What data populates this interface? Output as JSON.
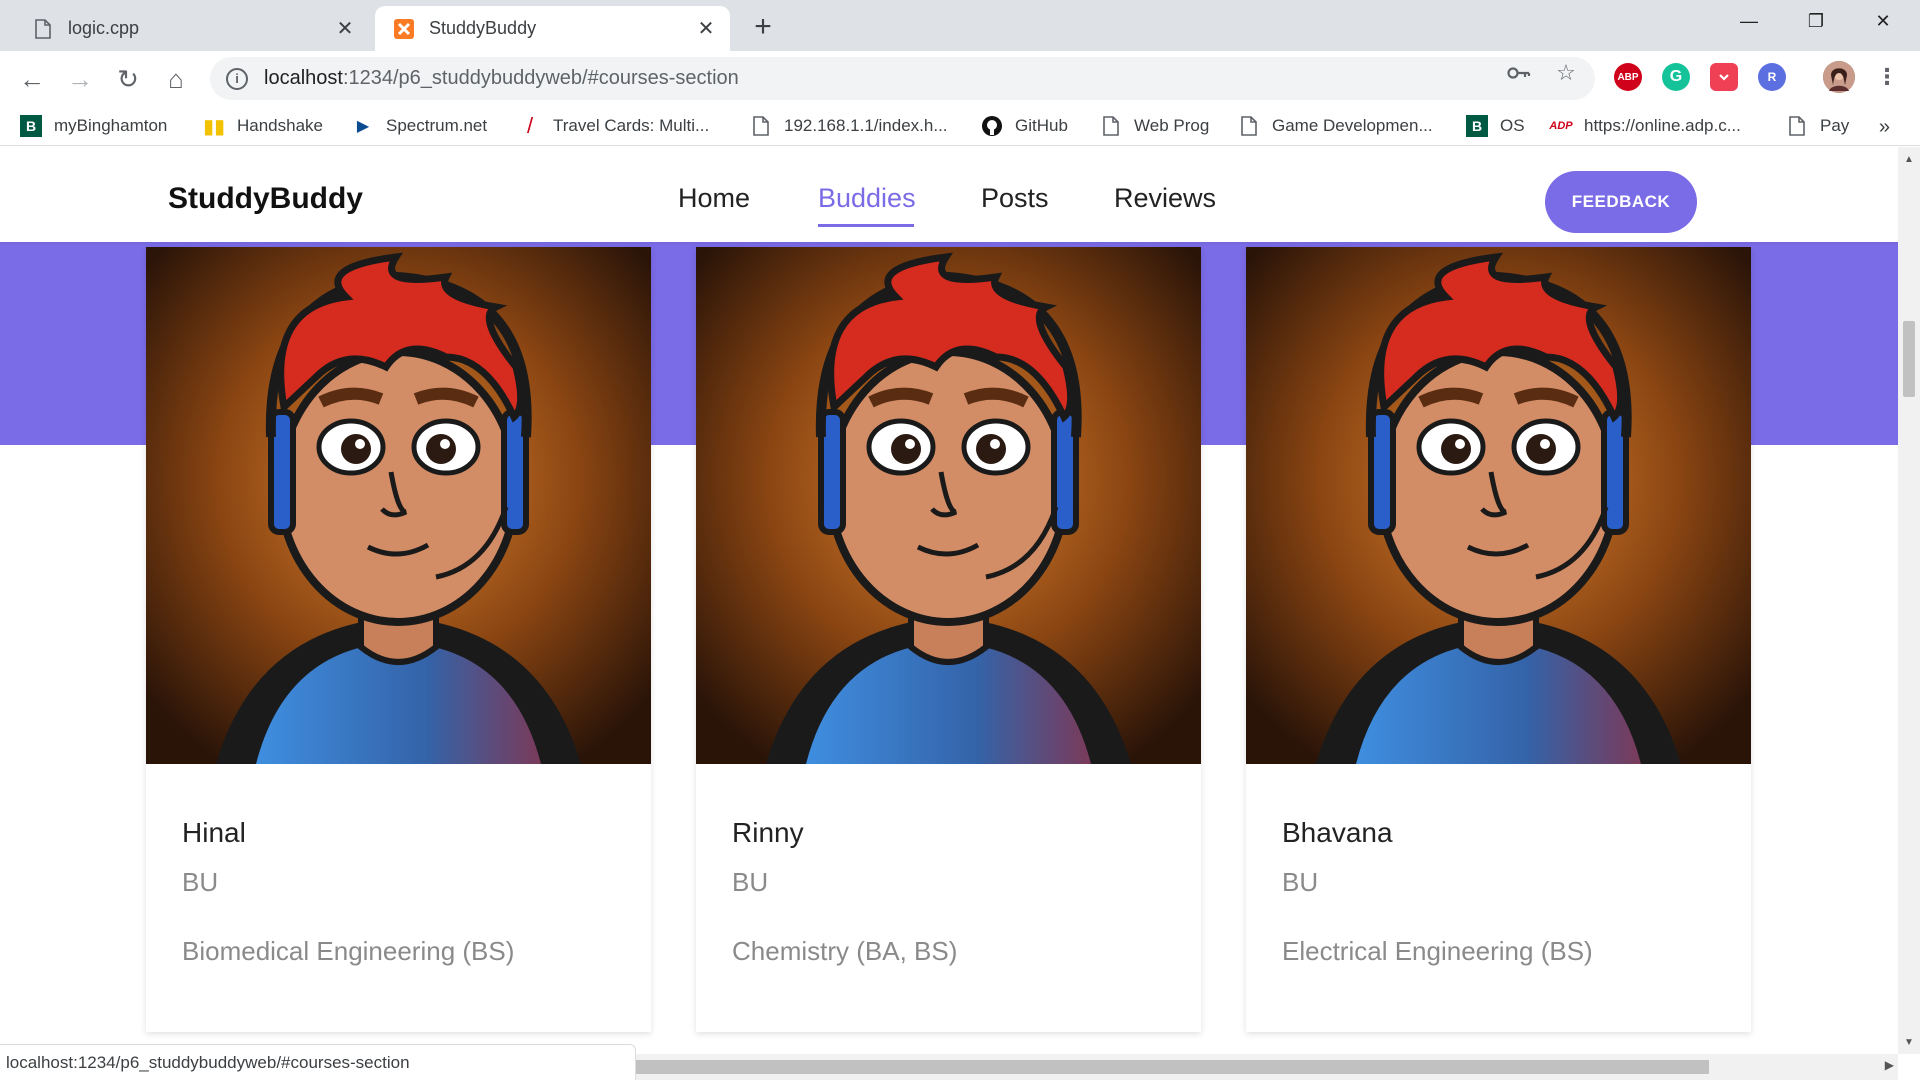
{
  "browser": {
    "tabs": [
      {
        "title": "logic.cpp",
        "icon": "file-icon",
        "active": false
      },
      {
        "title": "StuddyBuddy",
        "icon": "xampp-icon",
        "active": true
      }
    ],
    "new_tab_label": "+",
    "window_controls": {
      "minimize": "—",
      "restore": "❐",
      "close": "✕"
    },
    "address": {
      "host": "localhost",
      "path": ":1234/p6_studdybuddyweb/#courses-section"
    },
    "nav": {
      "back": "←",
      "forward": "→",
      "reload": "↻",
      "home": "⌂"
    },
    "extensions": [
      {
        "name": "abp-icon",
        "label": "ABP",
        "color": "#d0021b"
      },
      {
        "name": "grammarly-icon",
        "label": "G",
        "color": "#15c39a"
      },
      {
        "name": "pocket-icon",
        "label": "",
        "color": "#ef4056"
      },
      {
        "name": "r-extension-icon",
        "label": "R",
        "color": "#5b6fe0"
      }
    ],
    "bookmarks": [
      {
        "label": "myBinghamton",
        "icon": "binghamton-icon",
        "glyph": "B",
        "color": "#005a43"
      },
      {
        "label": "Handshake",
        "icon": "handshake-icon",
        "glyph": "h",
        "color": "#f2c200"
      },
      {
        "label": "Spectrum.net",
        "icon": "spectrum-icon",
        "glyph": "▶",
        "color": "#0b4b8f"
      },
      {
        "label": "Travel Cards: Multi...",
        "icon": "travel-cards-icon",
        "glyph": "/",
        "color": "#d0021b"
      },
      {
        "label": "192.168.1.1/index.h...",
        "icon": "page-icon",
        "glyph": "",
        "color": "#5f6368"
      },
      {
        "label": "GitHub",
        "icon": "github-icon",
        "glyph": "●",
        "color": "#111111"
      },
      {
        "label": "Web Prog",
        "icon": "page-icon",
        "glyph": "",
        "color": "#5f6368"
      },
      {
        "label": "Game Developmen...",
        "icon": "page-icon",
        "glyph": "",
        "color": "#5f6368"
      },
      {
        "label": "OS",
        "icon": "binghamton-icon",
        "glyph": "B",
        "color": "#005a43"
      },
      {
        "label": "https://online.adp.c...",
        "icon": "adp-icon",
        "glyph": "ADP",
        "color": "#d0021b"
      },
      {
        "label": "Pay",
        "icon": "page-icon",
        "glyph": "",
        "color": "#5f6368"
      }
    ],
    "bookmarks_more": "»",
    "status_url": "localhost:1234/p6_studdybuddyweb/#courses-section"
  },
  "site": {
    "brand": "StuddyBuddy",
    "nav": [
      {
        "label": "Home",
        "active": false
      },
      {
        "label": "Buddies",
        "active": true
      },
      {
        "label": "Posts",
        "active": false
      },
      {
        "label": "Reviews",
        "active": false
      }
    ],
    "feedback_label": "FEEDBACK",
    "accent": "#7a6be6"
  },
  "buddies": [
    {
      "name": "Hinal",
      "school": "BU",
      "major": "Biomedical Engineering (BS)"
    },
    {
      "name": "Rinny",
      "school": "BU",
      "major": "Chemistry (BA, BS)"
    },
    {
      "name": "Bhavana",
      "school": "BU",
      "major": "Electrical Engineering (BS)"
    }
  ]
}
